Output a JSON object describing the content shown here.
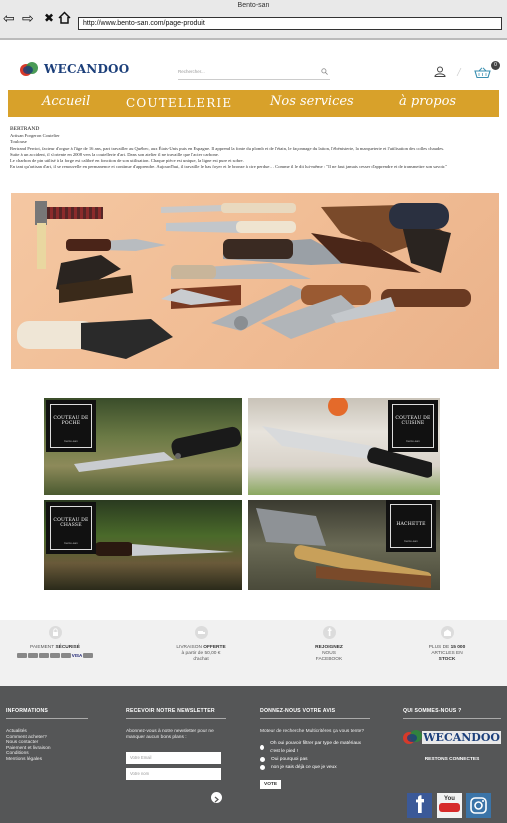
{
  "browser": {
    "window_title": "Bento-san",
    "url": "http://www.bento-san.com/page-produit"
  },
  "header": {
    "logo_text": "WECANDOO",
    "search_placeholder": "Rechercher...",
    "cart_count": "0"
  },
  "nav": {
    "items": [
      "Accueil",
      "COUTELLERIE",
      "Nos services",
      "à propos"
    ]
  },
  "article": {
    "author": "BERTRAND",
    "subtitle": "Artisan Forgeron Coutelier",
    "city": "Toulouse",
    "paragraphs": [
      "Bertrand Perriot, facteur d'orgue à l'âge de 16 ans, part travailler au Québec, aux États-Unis puis en Espagne. Il apprend la fonte du plomb et de l'étain, le façonnage du laiton, l'ébénisterie, la marqueterie et l'utilisation des colles chaudes.",
      "Suite à un accident, il s'oriente en 2008 vers la coutellerie d'art. Dans son atelier il ne travaille que l'acier carbone.",
      "Le charbon de pin utilisé à la forge est calibré en fonction de son utilisation. Chaque pièce est unique, la ligne est pure et sobre.",
      "En tant qu'artisan d'art, il se renouvelle en permanence et continue d'apprendre. Aujourd'hui, il travaille le bas foyer et le bronze à cire perdue… Comme il le dit lui-même : \"Il ne faut jamais cesser d'apprendre et de transmettre son savoir.\""
    ]
  },
  "categories": [
    {
      "title": "COUTEAU DE POCHE",
      "sub": "bento-san"
    },
    {
      "title": "COUTEAU DE CUISINE",
      "sub": "bento-san"
    },
    {
      "title": "COUTEAU DE CHASSE",
      "sub": "bento-san"
    },
    {
      "title": "HACHETTE",
      "sub": "bento-san"
    }
  ],
  "reassurance": {
    "payment": {
      "pre": "PAIEMENT ",
      "bold": "SÉCURISÉ",
      "card": "VISA"
    },
    "shipping": {
      "pre": "LIVRAISON ",
      "bold": "OFFERTE",
      "line2": "à partir de 50,00 €",
      "line3": "d'achat"
    },
    "facebook": {
      "bold": "REJOIGNEZ",
      "line2": "NOUS",
      "line3": "FACEBOOK"
    },
    "stock": {
      "pre": "PLUS DE ",
      "bold": "15 000",
      "line2": "ARTICLES EN",
      "line3": "STOCK"
    }
  },
  "footer": {
    "info": {
      "title": "INFORMATIONS",
      "links": [
        "Actualités",
        "Comment acheter?",
        "Nous contacter",
        "Paiement et livraison",
        "Conditions",
        "Mentions légales"
      ]
    },
    "newsletter": {
      "title_pre": "RECEVOIR NOTRE ",
      "title_bold": "NEWSLETTER",
      "text": "Abonnez-vous à notre newsletter pour ne manquer aucun bons plans :",
      "email_placeholder": "Votre Email",
      "name_placeholder": "Votre nom"
    },
    "poll": {
      "title_pre": "DONNEZ-NOUS VOTRE ",
      "title_bold": "AVIS",
      "question": "Moteur de recherche Multicritères ça vous tente?",
      "options": [
        "Oh oui pouvoir filtrer par type de matériaux c'est le pied !",
        "Oui pourquoi pas",
        "non je sais déjà ce que je veux"
      ],
      "button": "VOTE"
    },
    "about": {
      "title_pre": "QUI ",
      "title_bold": "SOMMES-NOUS ?",
      "logo_text": "WECANDOO",
      "stay_connected": "RESTONS CONNECTES",
      "youtube_label": "You"
    }
  },
  "colors": {
    "nav_gold": "#d8a12a",
    "brand_blue": "#1c3f7a",
    "footer_gray": "#555657",
    "hero_bg": "#f1bd95"
  }
}
